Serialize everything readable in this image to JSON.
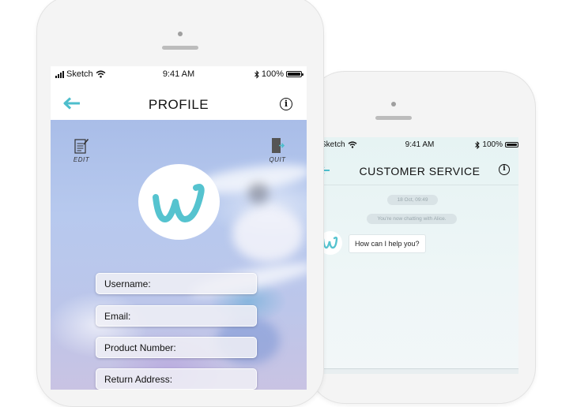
{
  "profile_screen": {
    "status": {
      "carrier": "Sketch",
      "time": "9:41 AM",
      "battery": "100%"
    },
    "title": "PROFILE",
    "edit_label": "EDIT",
    "quit_label": "QUIT",
    "fields": [
      {
        "label": "Username:"
      },
      {
        "label": "Email:"
      },
      {
        "label": "Product Number:"
      },
      {
        "label": "Return Address:"
      }
    ],
    "colors": {
      "accent": "#4dbecc",
      "logo": "#55c3cf"
    }
  },
  "chat_screen": {
    "status": {
      "carrier": "Sketch",
      "time": "9:41 AM",
      "battery": "100%"
    },
    "title": "CUSTOMER SERVICE",
    "timestamp": "18 Oct, 09:49",
    "system_notice": "You're now chatting with Alice.",
    "message": "How can I help you?"
  },
  "icons": [
    "back-arrow-icon",
    "info-icon",
    "edit-icon",
    "quit-door-icon",
    "wifi-icon",
    "bluetooth-icon",
    "battery-icon",
    "signal-icon",
    "brand-w-logo"
  ]
}
